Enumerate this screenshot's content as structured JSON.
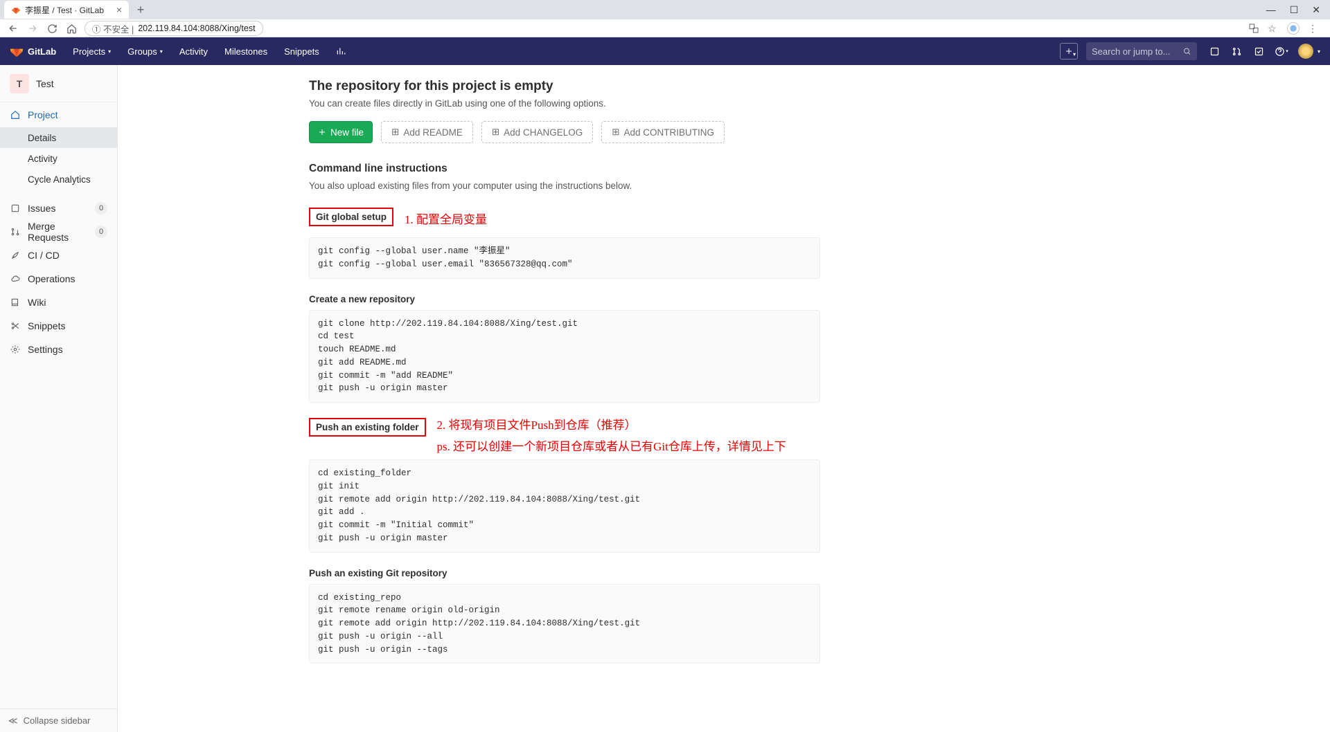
{
  "browser": {
    "tab_title": "李振星 / Test · GitLab",
    "url_prefix": "① 不安全 | ",
    "url": "202.119.84.104:8088/Xing/test"
  },
  "topnav": {
    "brand": "GitLab",
    "links": [
      "Projects",
      "Groups",
      "Activity",
      "Milestones",
      "Snippets"
    ],
    "search_placeholder": "Search or jump to..."
  },
  "sidebar": {
    "project_initial": "T",
    "project_name": "Test",
    "project_link": "Project",
    "sub": {
      "details": "Details",
      "activity": "Activity",
      "cycle": "Cycle Analytics"
    },
    "issues": "Issues",
    "issues_count": "0",
    "mr": "Merge Requests",
    "mr_count": "0",
    "cicd": "CI / CD",
    "ops": "Operations",
    "wiki": "Wiki",
    "snippets": "Snippets",
    "settings": "Settings",
    "collapse": "Collapse sidebar"
  },
  "page": {
    "title": "The repository for this project is empty",
    "subtitle": "You can create files directly in GitLab using one of the following options.",
    "btn_new": "New file",
    "btn_readme": "Add README",
    "btn_changelog": "Add CHANGELOG",
    "btn_contrib": "Add CONTRIBUTING",
    "cli_h": "Command line instructions",
    "cli_p": "You also upload existing files from your computer using the instructions below.",
    "global_h": "Git global setup",
    "annot1": "1. 配置全局变量",
    "global_code": "git config --global user.name \"李振星\"\ngit config --global user.email \"836567328@qq.com\"",
    "create_h": "Create a new repository",
    "create_code": "git clone http://202.119.84.104:8088/Xing/test.git\ncd test\ntouch README.md\ngit add README.md\ngit commit -m \"add README\"\ngit push -u origin master",
    "pushfolder_h": "Push an existing folder",
    "annot2": "2. 将现有项目文件Push到仓库（推荐）",
    "annot3": "ps. 还可以创建一个新项目仓库或者从已有Git仓库上传，详情见上下",
    "pushfolder_code": "cd existing_folder\ngit init\ngit remote add origin http://202.119.84.104:8088/Xing/test.git\ngit add .\ngit commit -m \"Initial commit\"\ngit push -u origin master",
    "pushrepo_h": "Push an existing Git repository",
    "pushrepo_code": "cd existing_repo\ngit remote rename origin old-origin\ngit remote add origin http://202.119.84.104:8088/Xing/test.git\ngit push -u origin --all\ngit push -u origin --tags"
  }
}
